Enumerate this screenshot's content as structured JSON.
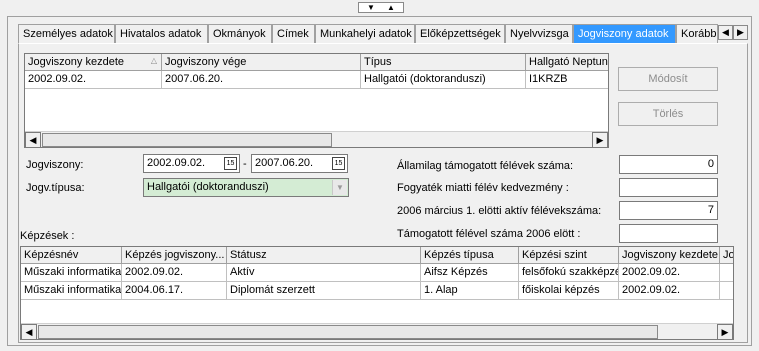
{
  "tabs": [
    "Személyes adatok",
    "Hivatalos adatok",
    "Okmányok",
    "Címek",
    "Munkahelyi adatok",
    "Előképzettségek",
    "Nyelvvizsga",
    "Jogviszony adatok",
    "Korábbi"
  ],
  "upper_grid": {
    "columns": [
      "Jogviszony kezdete",
      "Jogviszony vége",
      "Típus",
      "Hallgató Neptun"
    ],
    "rows": [
      [
        "2002.09.02.",
        "2007.06.20.",
        "Hallgatói (doktoranduszi)",
        "I1KRZB"
      ]
    ]
  },
  "buttons": {
    "modify": "Módosít",
    "delete": "Törlés"
  },
  "form": {
    "jogviszony_label": "Jogviszony:",
    "start_date": "2002.09.02.",
    "dash": "-",
    "end_date": "2007.06.20.",
    "type_label": "Jogv.típusa:",
    "type_value": "Hallgatói (doktoranduszi)",
    "cal_icon": "15"
  },
  "right_fields": [
    {
      "label": "Államilag támogatott félévek száma:",
      "value": "0"
    },
    {
      "label": "Fogyaték miatti félév kedvezmény :",
      "value": ""
    },
    {
      "label": "2006 március 1. elötti aktív félévekszáma:",
      "value": "7"
    },
    {
      "label": "Támogatott félével száma 2006 elött :",
      "value": ""
    }
  ],
  "kepzesek_label": "Képzések :",
  "lower_grid": {
    "columns": [
      "Képzésnév",
      "Képzés jogviszony...",
      "Státusz",
      "Képzés típusa",
      "Képzési szint",
      "Jogviszony kezdete",
      "Jo"
    ],
    "rows": [
      [
        "Műszaki informatika",
        "2002.09.02.",
        "Aktív",
        "Aifsz Képzés",
        "felsőfokú szakképzés",
        "2002.09.02.",
        ""
      ],
      [
        "Műszaki informatika",
        "2004.06.17.",
        "Diplomát szerzett",
        "1. Alap",
        "főiskolai képzés",
        "2002.09.02.",
        ""
      ]
    ]
  }
}
